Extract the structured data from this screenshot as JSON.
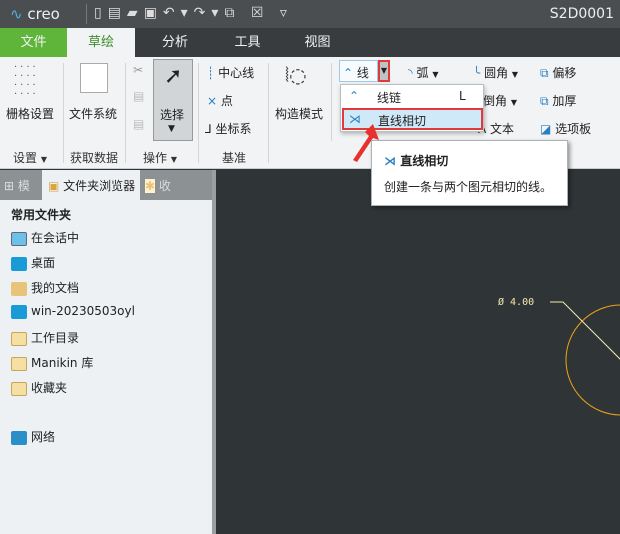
{
  "titlebar": {
    "logo": "creo",
    "title": "S2D0001"
  },
  "tabs": [
    {
      "label": "文件"
    },
    {
      "label": "草绘"
    },
    {
      "label": "分析"
    },
    {
      "label": "工具"
    },
    {
      "label": "视图"
    }
  ],
  "ribbon": {
    "grid_settings": "栅格设置",
    "file_system": "文件系统",
    "select": "选择",
    "centerline": "中心线",
    "point": "点",
    "coord_sys": "坐标系",
    "construction_mode": "构造模式",
    "line": "线",
    "arc": "弧",
    "fillet": "圆角",
    "offset": "偏移",
    "chamfer": "倒角",
    "thicken": "加厚",
    "text": "文本",
    "palette": "选项板",
    "groups": {
      "settings": "设置",
      "get_data": "获取数据",
      "operations": "操作",
      "datum": "基准"
    }
  },
  "line_menu": {
    "items": [
      {
        "label": "线链",
        "shortcut": "L"
      },
      {
        "label": "直线相切"
      }
    ]
  },
  "tooltip": {
    "title": "直线相切",
    "description": "创建一条与两个图元相切的线。"
  },
  "left_panel": {
    "tabs": [
      "模",
      "文件夹浏览器",
      "收"
    ],
    "heading": "常用文件夹",
    "items": [
      {
        "label": "在会话中",
        "color": "#6cc0ea"
      },
      {
        "label": "桌面",
        "color": "#1a9ad6"
      },
      {
        "label": "我的文档",
        "color": "#e8c47a"
      },
      {
        "label": "win-20230503oyl",
        "color": "#1a9ad6"
      },
      {
        "label": "工作目录",
        "color": "#f5dfa2"
      },
      {
        "label": "Manikin 库",
        "color": "#f5dfa2"
      },
      {
        "label": "收藏夹",
        "color": "#f5dfa2"
      }
    ],
    "network": "网络"
  },
  "canvas": {
    "dimension": "Ø 4.00",
    "circle_color": "#f2a21a"
  }
}
